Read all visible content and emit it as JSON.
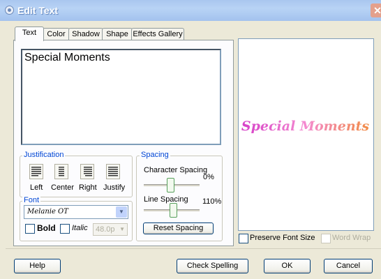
{
  "window": {
    "title": "Edit Text"
  },
  "tabs": [
    "Text",
    "Color",
    "Shadow",
    "Shape",
    "Effects Gallery"
  ],
  "text_panel": {
    "content": "Special Moments",
    "justification": {
      "label": "Justification",
      "options": [
        "Left",
        "Center",
        "Right",
        "Justify"
      ]
    },
    "font": {
      "label": "Font",
      "selected": "Melanie OT",
      "bold_label": "Bold",
      "italic_label": "Italic",
      "size": "48.0p"
    },
    "spacing": {
      "label": "Spacing",
      "character_spacing_label": "Character Spacing",
      "character_spacing_value": "0%",
      "line_spacing_label": "Line Spacing",
      "line_spacing_value": "110%",
      "reset_label": "Reset Spacing"
    }
  },
  "preview": {
    "text": "Special Moments",
    "gradient": [
      "#d43cc8",
      "#f48ad0",
      "#f28c3e"
    ]
  },
  "options": {
    "preserve_font_size_label": "Preserve Font Size",
    "word_wrap_label": "Word Wrap"
  },
  "buttons": {
    "help": "Help",
    "check_spelling": "Check Spelling",
    "ok": "OK",
    "cancel": "Cancel"
  },
  "colors": {
    "accent": "#0046d5",
    "titlebar": "#a9c6ef"
  }
}
